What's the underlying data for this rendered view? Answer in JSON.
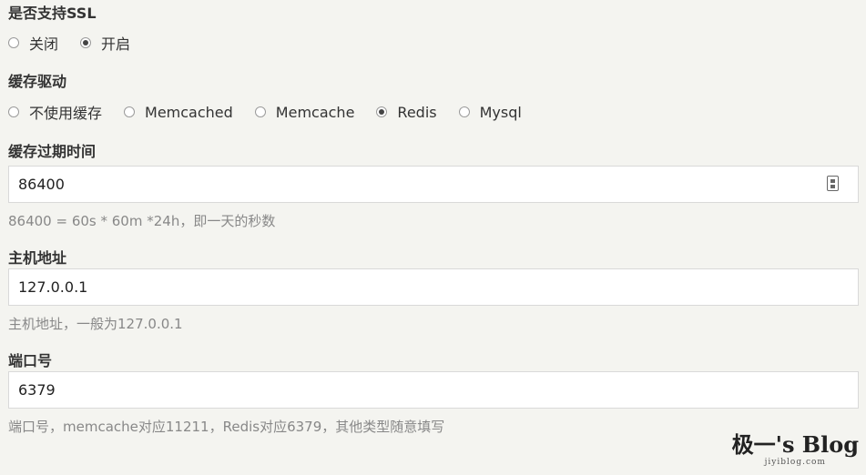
{
  "ssl": {
    "label": "是否支持SSL",
    "options": [
      {
        "label": "关闭",
        "checked": false
      },
      {
        "label": "开启",
        "checked": true
      }
    ]
  },
  "driver": {
    "label": "缓存驱动",
    "options": [
      {
        "label": "不使用缓存",
        "checked": false
      },
      {
        "label": "Memcached",
        "checked": false
      },
      {
        "label": "Memcache",
        "checked": false
      },
      {
        "label": "Redis",
        "checked": true
      },
      {
        "label": "Mysql",
        "checked": false
      }
    ]
  },
  "expire": {
    "label": "缓存过期时间",
    "value": "86400",
    "help": "86400 = 60s * 60m *24h，即一天的秒数"
  },
  "host": {
    "label": "主机地址",
    "value": "127.0.0.1",
    "help": "主机地址，一般为127.0.0.1"
  },
  "port": {
    "label": "端口号",
    "value": "6379",
    "help": "端口号，memcache对应11211，Redis对应6379，其他类型随意填写"
  },
  "watermark": {
    "title": "极一's Blog",
    "subtitle": "jiyiblog.com"
  }
}
